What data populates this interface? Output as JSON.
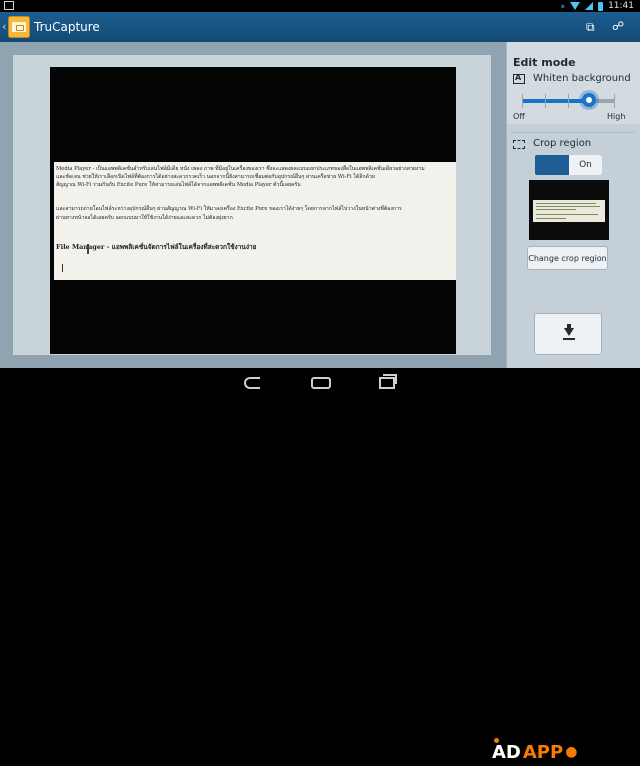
{
  "status": {
    "time": "11:41"
  },
  "actionbar": {
    "title": "TruCapture"
  },
  "document": {
    "lines": [
      "Media Player - เป็นแอพพลิเคชั่นสำหรับเล่นไฟล์มีเดีย หนัง เพลง ภาพ ที่มีอยู่ในเครื่องของเรา ซึ่งจะแสดงผลแบบแยกประเภทของสื่อในแอพพลิเคชั่นเดียวอย่างสวยงาม",
      "และชัดเจน ช่วยให้เราเลือกเปิดไฟล์ที่ต้องการได้อย่างสะดวกรวดเร็ว นอกจากนี้ยังสามารถเชื่อมต่อกับอุปกรณ์อื่นๆ ผ่านเครือข่าย Wi-Fi ได้อีกด้วย",
      "สัญญาณ Wi-Fi ร่วมกันกับ Excite Pure ให้สามารถเล่นไฟล์ได้จากแอพพลิเคชั่น Media Player ตัวนี้เลยครับ",
      "และสามารถถ่ายโอนไฟล์ระหว่างอุปกรณ์อื่นๆ ผ่านสัญญาณ Wi-Fi ให้มาลงเครื่อง Excite Pure ของเราได้ง่ายๆ โดยการลากไฟล์ไปวางในหน้าต่างที่ต้องการ",
      "ผ่านทางหน้าจอได้เลยครับ ออกแบบมาให้ใช้งานได้ง่ายและสะดวก ไม่ต้องยุ่งยาก",
      "File Manager - แอพพลิเคชั่นจัดการไฟล์ในเครื่องที่สะดวกใช้งานง่าย"
    ]
  },
  "panel": {
    "edit_mode": "Edit mode",
    "whiten_label": "Whiten background",
    "whiten_value": 0.72,
    "slider_off": "Off",
    "slider_high": "High",
    "crop_region": "Crop region",
    "crop_toggle": "On",
    "change_crop": "Change crop region"
  },
  "watermark": {
    "part1": "AD",
    "part2": "APP"
  },
  "colors": {
    "accent": "#1a73c8",
    "actionbar": "#1c5d8f",
    "panel": "#c5cfd7",
    "brand": "#f57c00"
  }
}
